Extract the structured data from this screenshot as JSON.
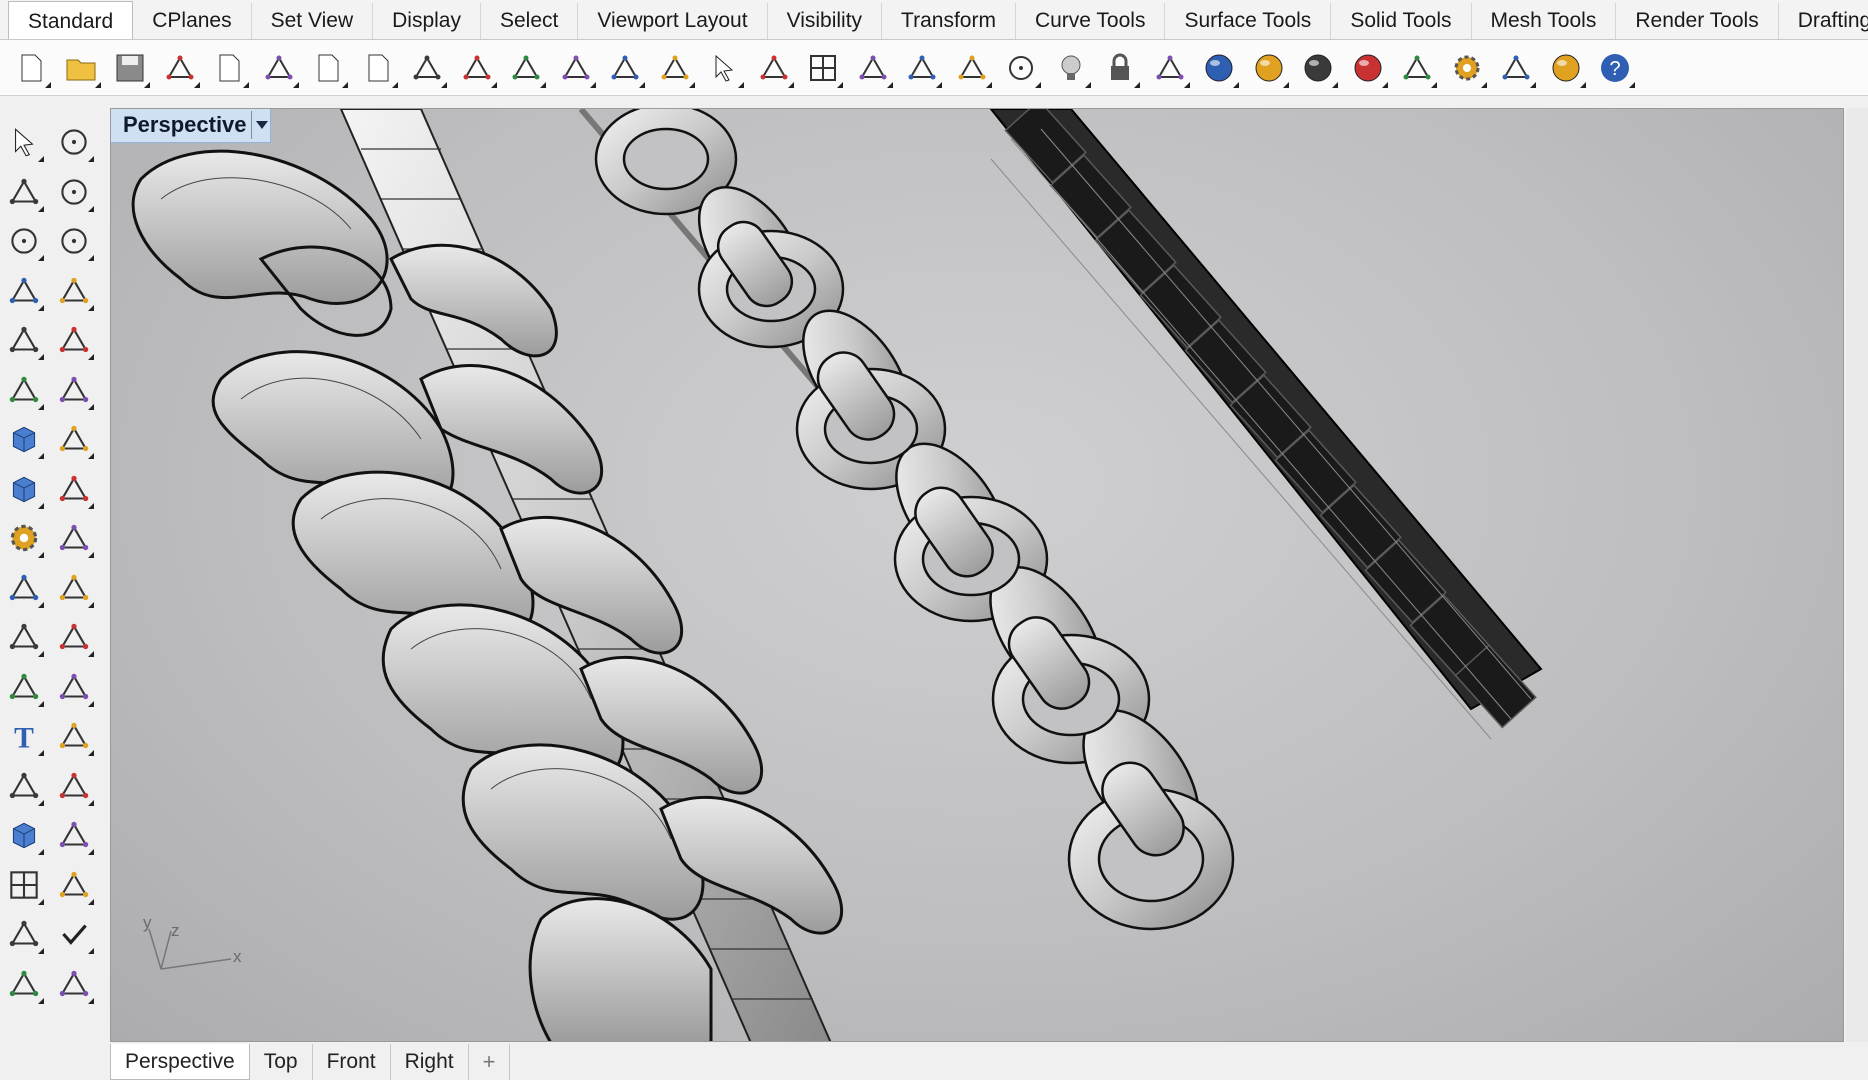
{
  "tabs": [
    {
      "label": "Standard",
      "active": true
    },
    {
      "label": "CPlanes"
    },
    {
      "label": "Set View"
    },
    {
      "label": "Display"
    },
    {
      "label": "Select"
    },
    {
      "label": "Viewport Layout"
    },
    {
      "label": "Visibility"
    },
    {
      "label": "Transform"
    },
    {
      "label": "Curve Tools"
    },
    {
      "label": "Surface Tools"
    },
    {
      "label": "Solid Tools"
    },
    {
      "label": "Mesh Tools"
    },
    {
      "label": "Render Tools"
    },
    {
      "label": "Drafting"
    }
  ],
  "toolbar_icons": [
    "new-file-icon",
    "open-folder-icon",
    "save-icon",
    "print-icon",
    "import-icon",
    "cut-icon",
    "copy-icon",
    "paste-icon",
    "undo-icon",
    "pan-hand-icon",
    "rotate-view-icon",
    "zoom-dynamic-icon",
    "zoom-window-icon",
    "zoom-extents-icon",
    "zoom-selected-icon",
    "undo-view-icon",
    "four-viewports-icon",
    "car-properties-icon",
    "cplane-icon",
    "object-snap-icon",
    "select-points-icon",
    "lightbulb-icon",
    "lock-icon",
    "layer-icon",
    "color-wheel-icon",
    "shaded-sphere-icon",
    "rendered-sphere-icon",
    "blue-sphere-icon",
    "filter-icon",
    "settings-gear-icon",
    "dimension-icon",
    "globe-icon",
    "help-icon"
  ],
  "left_tools": [
    "select-arrow-icon",
    "point-icon",
    "polyline-icon",
    "curve-points-icon",
    "circle-icon",
    "ellipse-icon",
    "arc-icon",
    "rectangle-icon",
    "polygon-icon",
    "fillet-curve-icon",
    "surface-corner-icon",
    "surface-patch-icon",
    "box-icon",
    "boolean-union-icon",
    "cylinder-icon",
    "plane-surface-icon",
    "gears-icon",
    "explode-icon",
    "trim-icon",
    "split-icon",
    "group-icon",
    "ungroup-icon",
    "offset-curve-icon",
    "blend-curve-icon",
    "text-icon",
    "scale-icon",
    "array-icon",
    "mirror-icon",
    "extrude-icon",
    "dim-icon",
    "grid-array-icon",
    "align-icon",
    "project-icon",
    "check-icon",
    "mesh-icon",
    "cage-edit-icon"
  ],
  "viewport": {
    "title": "Perspective",
    "axis_labels": {
      "x": "x",
      "y": "y",
      "z": "z"
    }
  },
  "bottom_tabs": [
    {
      "label": "Perspective",
      "active": true
    },
    {
      "label": "Top"
    },
    {
      "label": "Front"
    },
    {
      "label": "Right"
    },
    {
      "label": "+"
    }
  ]
}
